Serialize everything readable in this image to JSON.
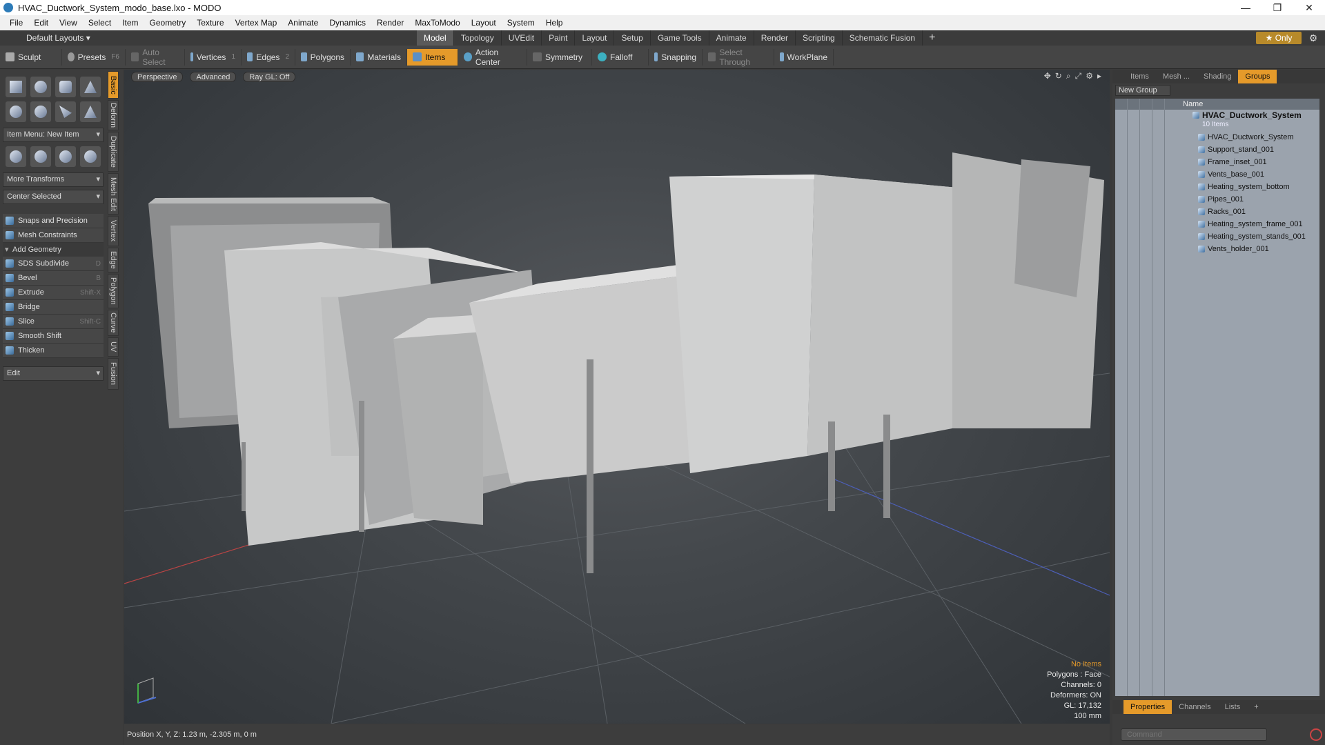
{
  "window": {
    "title": "HVAC_Ductwork_System_modo_base.lxo - MODO",
    "controls": [
      "—",
      "❐",
      "✕"
    ]
  },
  "menu": [
    "File",
    "Edit",
    "View",
    "Select",
    "Item",
    "Geometry",
    "Texture",
    "Vertex Map",
    "Animate",
    "Dynamics",
    "Render",
    "MaxToModo",
    "Layout",
    "System",
    "Help"
  ],
  "layout": {
    "selector": "Default Layouts ▾",
    "tabs": [
      "Model",
      "Topology",
      "UVEdit",
      "Paint",
      "Layout",
      "Setup",
      "Game Tools",
      "Animate",
      "Render",
      "Scripting",
      "Schematic Fusion"
    ],
    "active_tab": "Model",
    "plus": "+",
    "only": "★  Only",
    "gear": "⚙"
  },
  "toolbar": {
    "sculpt": "Sculpt",
    "presets": "Presets",
    "presets_key": "F6",
    "autoselect": "Auto Select",
    "vertices": "Vertices",
    "vertices_key": "1",
    "edges": "Edges",
    "edges_key": "2",
    "polygons": "Polygons",
    "materials": "Materials",
    "items": "Items",
    "action_center": "Action Center",
    "symmetry": "Symmetry",
    "falloff": "Falloff",
    "snapping": "Snapping",
    "select_through": "Select Through",
    "workplane": "WorkPlane"
  },
  "left": {
    "item_menu": "Item Menu: New Item",
    "more_transforms": "More Transforms",
    "center_selected": "Center Selected",
    "snaps": "Snaps and Precision",
    "mesh_constraints": "Mesh Constraints",
    "add_geometry": "Add Geometry",
    "tools": [
      {
        "label": "SDS Subdivide",
        "key": "D"
      },
      {
        "label": "Bevel",
        "key": "B"
      },
      {
        "label": "Extrude",
        "key": "Shift-X"
      },
      {
        "label": "Bridge",
        "key": ""
      },
      {
        "label": "Slice",
        "key": "Shift-C"
      },
      {
        "label": "Smooth Shift",
        "key": ""
      },
      {
        "label": "Thicken",
        "key": ""
      }
    ],
    "edit": "Edit",
    "vtabs": [
      "Basic",
      "Deform",
      "Duplicate",
      "Mesh Edit",
      "Vertex",
      "Edge",
      "Polygon",
      "Curve",
      "UV",
      "Fusion"
    ]
  },
  "viewport": {
    "perspective": "Perspective",
    "advanced": "Advanced",
    "raygl": "Ray GL: Off",
    "info": {
      "items": "No Items",
      "polygons": "Polygons : Face",
      "channels": "Channels: 0",
      "deformers": "Deformers: ON",
      "gl": "GL: 17,132",
      "scale": "100 mm"
    }
  },
  "status": {
    "position": "Position X, Y, Z:   1.23 m, -2.305 m, 0 m"
  },
  "right": {
    "tabs": [
      "Items",
      "Mesh ...",
      "Shading",
      "Groups"
    ],
    "active_tab": "Groups",
    "new_group": "New Group",
    "col_name": "Name",
    "group_title": "HVAC_Ductwork_System",
    "group_count": "10 Items",
    "items": [
      "HVAC_Ductwork_System",
      "Support_stand_001",
      "Frame_inset_001",
      "Vents_base_001",
      "Heating_system_bottom",
      "Pipes_001",
      "Racks_001",
      "Heating_system_frame_001",
      "Heating_system_stands_001",
      "Vents_holder_001"
    ],
    "bottom_tabs": [
      "Properties",
      "Channels",
      "Lists",
      "+"
    ],
    "bottom_active": "Properties",
    "command_placeholder": "Command"
  }
}
